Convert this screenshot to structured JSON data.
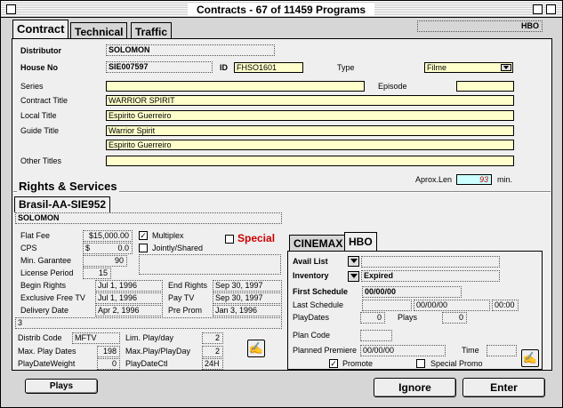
{
  "window": {
    "title": "Contracts - 67 of 11459 Programs"
  },
  "tabs": [
    "Contract",
    "Technical",
    "Traffic"
  ],
  "channel_badge": "HBO",
  "contract": {
    "distributor_label": "Distributor",
    "distributor": "SOLOMON",
    "house_no_label": "House No",
    "house_no": "SIE007597",
    "id_label": "ID",
    "id": "FHSO1601",
    "type_label": "Type",
    "type": "Filme",
    "series_label": "Series",
    "series": "",
    "episode_label": "Episode",
    "episode": "",
    "contract_title_label": "Contract Title",
    "contract_title": "WARRIOR SPIRIT",
    "local_title_label": "Local Title",
    "local_title": "Espirito Guerreiro",
    "guide_title_label": "Guide Title",
    "guide_title_1": "Warrior Spirit",
    "guide_title_2": "Espirito Guerreiro",
    "other_titles_label": "Other Titles",
    "other_titles": "",
    "aprox_len_label": "Aprox.Len",
    "aprox_len": "93",
    "min_label": "min."
  },
  "rights": {
    "section_title": "Rights & Services",
    "deal_tab": "Brasil-AA-SIE952",
    "distributor": "SOLOMON",
    "flat_fee_label": "Flat Fee",
    "flat_fee": "$15,000.00",
    "multiplex_label": "Multiplex",
    "multiplex_checked": true,
    "cps_label": "CPS",
    "cps_currency": "$",
    "cps": "0.0",
    "jointly_label": "Jointly/Shared",
    "jointly_checked": false,
    "special_label": "Special",
    "special_checked": false,
    "min_garantee_label": "Min. Garantee",
    "min_garantee": "90",
    "license_period_label": "License Period",
    "license_period": "15",
    "begin_rights_label": "Begin Rights",
    "begin_rights": "Jul 1, 1996",
    "end_rights_label": "End Rights",
    "end_rights": "Sep 30, 1997",
    "excl_free_tv_label": "Exclusive Free TV",
    "excl_free_tv": "Jul 1, 1996",
    "pay_tv_label": "Pay TV",
    "pay_tv": "Sep 30, 1997",
    "delivery_date_label": "Delivery Date",
    "delivery_date": "Apr 2, 1996",
    "pre_prom_label": "Pre Prom",
    "pre_prom": "Jan 3, 1996",
    "notes": "3",
    "distrib_code_label": "Distrib Code",
    "distrib_code": "MFTV",
    "lim_playday_label": "Lim. Play/day",
    "lim_playday": "2",
    "max_play_dates_label": "Max. Play Dates",
    "max_play_dates": "198",
    "max_play_playday_label": "Max.Play/PlayDay",
    "max_play_playday": "2",
    "playdate_weight_label": "PlayDateWeight",
    "playdate_weight": "0",
    "playdate_ctl_label": "PlayDateCtl",
    "playdate_ctl": "24H"
  },
  "services": {
    "tabs": [
      "CINEMAX",
      "HBO"
    ],
    "avail_list_label": "Avail List",
    "avail_list": "",
    "inventory_label": "Inventory",
    "inventory": "Expired",
    "first_schedule_label": "First Schedule",
    "first_schedule": "00/00/00",
    "last_schedule_label": "Last Schedule",
    "last_schedule_date": "00/00/00",
    "last_schedule_time": "00:00",
    "play_dates_label": "PlayDates",
    "play_dates": "0",
    "plays_label": "Plays",
    "plays": "0",
    "plan_code_label": "Plan Code",
    "plan_code": "",
    "planned_premiere_label": "Planned Premiere",
    "planned_premiere": "00/00/00",
    "time_label": "Time",
    "time": "",
    "promote_label": "Promote",
    "promote_checked": true,
    "special_promo_label": "Special Promo",
    "special_promo_checked": false
  },
  "buttons": {
    "plays": "Plays",
    "ignore": "Ignore",
    "enter": "Enter"
  },
  "icons": [
    "close-box-icon",
    "zoom-box-icon",
    "collapse-box-icon",
    "edit-hand-icon"
  ]
}
